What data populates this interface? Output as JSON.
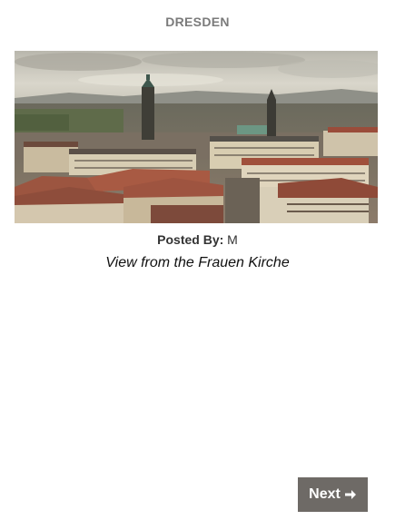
{
  "header": {
    "title": "DRESDEN"
  },
  "photo": {
    "subject": "Dresden cityscape panorama"
  },
  "post": {
    "posted_by_label": "Posted By:",
    "posted_by_value": "M",
    "caption": "View from the Frauen Kirche"
  },
  "navigation": {
    "next_label": "Next",
    "next_icon": "arrow-right-icon"
  },
  "colors": {
    "title": "#7b7b7b",
    "button_bg": "#6e6a66",
    "button_text": "#ffffff"
  }
}
